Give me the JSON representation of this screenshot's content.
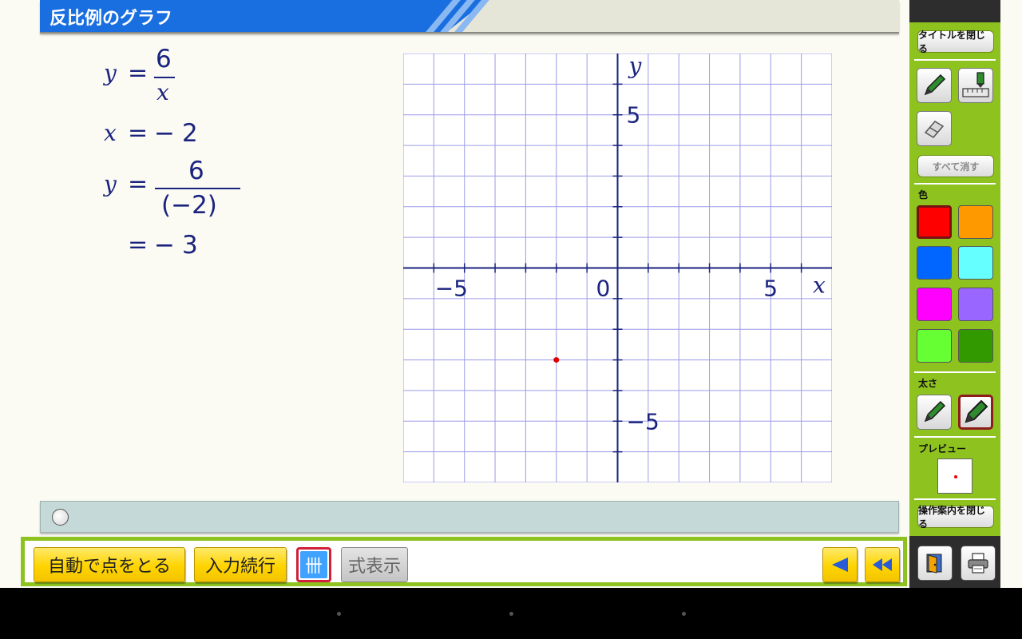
{
  "title": "反比例のグラフ",
  "equations": {
    "line1": {
      "var": "y",
      "eq": "=",
      "numerator": "6",
      "denominator": "x"
    },
    "line2": {
      "var": "x",
      "eq": "=",
      "sign": "−",
      "value": "2"
    },
    "line3": {
      "var": "y",
      "eq": "=",
      "numerator": "6",
      "denominator": "(−2)"
    },
    "line4": {
      "eq": "=",
      "sign": "−",
      "value": "3"
    }
  },
  "chart_data": {
    "type": "scatter",
    "title": "",
    "xlabel": "x",
    "ylabel": "y",
    "xlim": [
      -7,
      7
    ],
    "ylim": [
      -7,
      7
    ],
    "grid": true,
    "tick_labels": {
      "x_neg": "−5",
      "x_pos": "5",
      "y_pos": "5",
      "y_neg": "−5",
      "origin": "0"
    },
    "points": [
      {
        "x": -2,
        "y": -3,
        "color": "#e00000"
      }
    ]
  },
  "bottom_toolbar": {
    "auto_plot": "自動で点をとる",
    "continue_input": "入力続行",
    "grid_toggle": "卌",
    "show_formula": "式表示"
  },
  "right_panel": {
    "close_title": "タイトルを閉じる",
    "clear_all": "すべて消す",
    "color_label": "色",
    "thickness_label": "太さ",
    "preview_label": "プレビュー",
    "close_guide": "操作案内を閉じる",
    "colors": [
      "#ff0000",
      "#ff9900",
      "#0066ff",
      "#66ffff",
      "#ff00ff",
      "#9966ff",
      "#66ff33",
      "#339900"
    ],
    "selected_color": "#ff0000"
  },
  "icons": {
    "pen": "pen-icon",
    "ruler_pen": "ruler-pen-icon",
    "eraser": "eraser-icon",
    "exit": "exit-door-icon",
    "print": "printer-icon",
    "back": "triangle-left-icon",
    "rewind": "double-triangle-left-icon"
  }
}
